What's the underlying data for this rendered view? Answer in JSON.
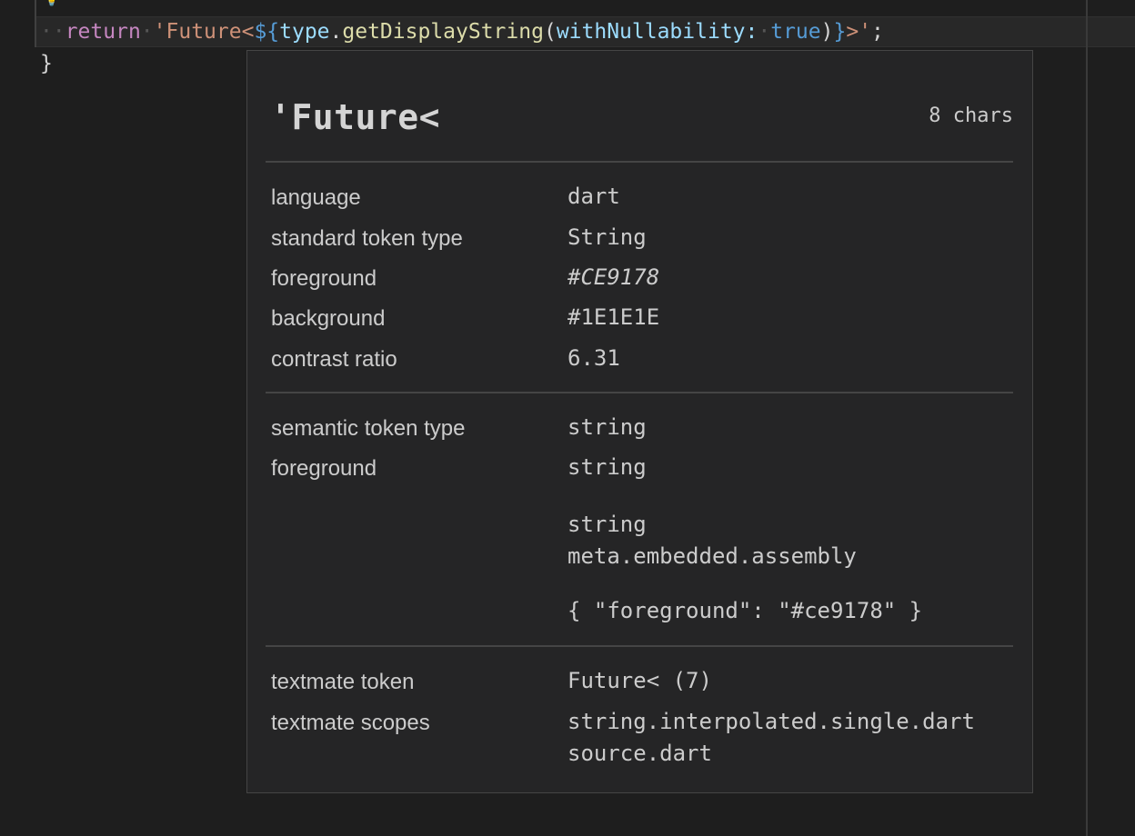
{
  "editor": {
    "lightbulb_icon": "lightbulb-icon",
    "line1": {
      "indent": "··",
      "keyword": "return",
      "space": "·",
      "string_start": "'Future<",
      "interp_open": "${",
      "var": "type",
      "dot": ".",
      "method": "getDisplayString",
      "paren_open": "(",
      "param": "withNullability:",
      "space2": "·",
      "bool": "true",
      "paren_close": ")",
      "interp_close": "}",
      "string_end": ">'",
      "semicolon": ";"
    },
    "line2": {
      "brace": "}"
    }
  },
  "hover": {
    "token_text": "'Future<",
    "char_count": "8 chars",
    "standard": [
      {
        "label": "language",
        "value": "dart"
      },
      {
        "label": "standard token type",
        "value": "String"
      },
      {
        "label": "foreground",
        "value": "#CE9178"
      },
      {
        "label": "background",
        "value": "#1E1E1E"
      },
      {
        "label": "contrast ratio",
        "value": "6.31"
      }
    ],
    "semantic": {
      "type_label": "semantic token type",
      "type_value": "string",
      "fg_label": "foreground",
      "fg_value": "string",
      "rule_line1": "string",
      "rule_line2": "meta.embedded.assembly",
      "rule_json": "{ \"foreground\": \"#ce9178\" }"
    },
    "textmate": {
      "token_label": "textmate token",
      "token_value": "Future< (7)",
      "scopes_label": "textmate scopes",
      "scope1": "string.interpolated.single.dart",
      "scope2": "source.dart"
    }
  },
  "colors": {
    "background": "#1e1e1e",
    "hover_background": "#252526",
    "string": "#ce9178",
    "keyword": "#c586c0",
    "variable": "#9cdcfe",
    "function": "#dcdcaa",
    "boolean": "#569cd6"
  }
}
